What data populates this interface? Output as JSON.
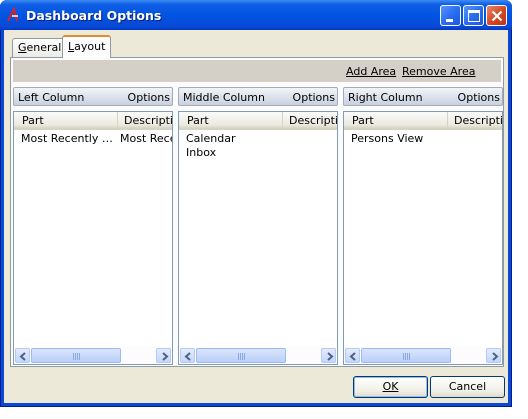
{
  "window": {
    "title": "Dashboard Options",
    "controls": {
      "minimize": "minimize",
      "maximize": "maximize",
      "close": "close"
    }
  },
  "tabs": [
    {
      "label": "General",
      "accesskey": "G",
      "selected": false
    },
    {
      "label": "Layout",
      "accesskey": "L",
      "selected": true
    }
  ],
  "actions": {
    "add_area": "Add Area",
    "remove_area": "Remove Area"
  },
  "columns": [
    {
      "title": "Left Column",
      "options": "Options",
      "headers": [
        "Part",
        "Description"
      ],
      "rows": [
        {
          "part": "Most Recently Used",
          "description": "Most Recently Used"
        }
      ]
    },
    {
      "title": "Middle Column",
      "options": "Options",
      "headers": [
        "Part",
        "Description"
      ],
      "rows": [
        {
          "part": "Calendar",
          "description": ""
        },
        {
          "part": "Inbox",
          "description": ""
        }
      ]
    },
    {
      "title": "Right Column",
      "options": "Options",
      "headers": [
        "Part",
        "Description"
      ],
      "rows": [
        {
          "part": "Persons View",
          "description": ""
        }
      ]
    }
  ],
  "buttons": {
    "ok": "OK",
    "cancel": "Cancel"
  },
  "colors": {
    "titlebar": "#0053e1",
    "dialog_bg": "#ece9d8",
    "tab_highlight": "#e68b2c"
  }
}
